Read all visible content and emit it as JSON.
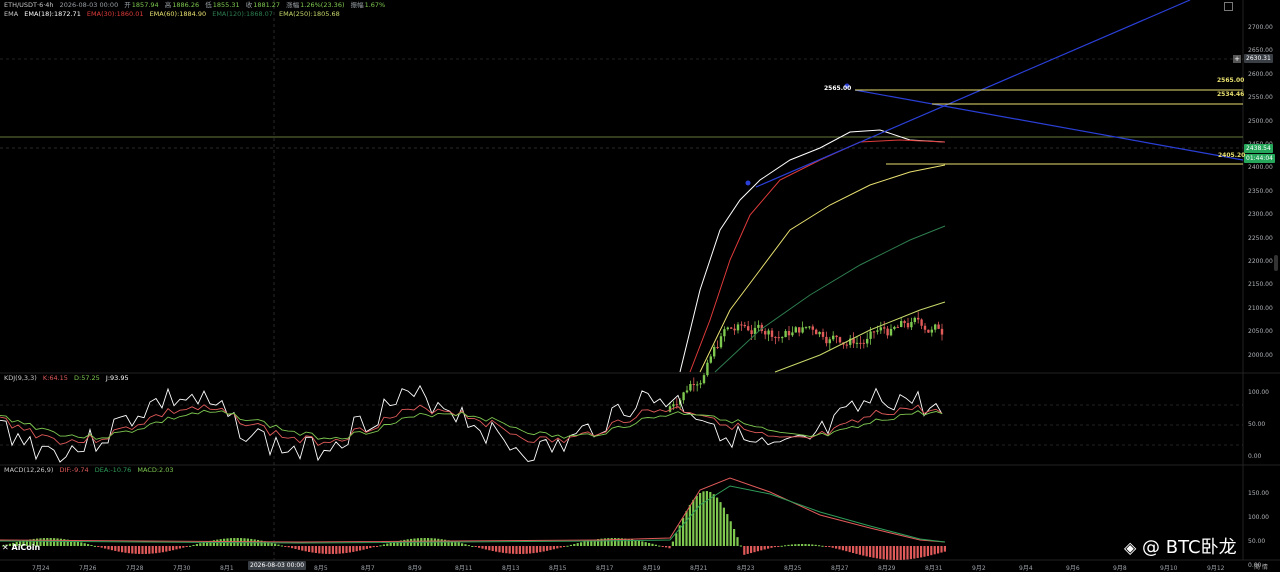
{
  "header": {
    "symbol": "ETH/USDT·6·4h",
    "datetime": "2026-08-03 00:00",
    "open_label": "开",
    "open": "1857.94",
    "high_label": "高",
    "high": "1886.26",
    "low_label": "低",
    "low": "1855.31",
    "close_label": "收",
    "close": "1881.27",
    "change_label": "涨幅",
    "change": "1.26%(23.36)",
    "amplitude_label": "振幅",
    "amplitude": "1.67%"
  },
  "ema": {
    "label": "EMA",
    "items": [
      {
        "text": "EMA(18):1872.71",
        "color": "#ffffff"
      },
      {
        "text": "EMA(30):1860.01",
        "color": "#e03b3b"
      },
      {
        "text": "EMA(60):1884.90",
        "color": "#e8e070"
      },
      {
        "text": "EMA(120):1868.07",
        "color": "#2e7d4f"
      },
      {
        "text": "EMA(250):1805.68",
        "color": "#c8d86a"
      }
    ]
  },
  "kdj": {
    "label": "KDJ(9,3,3)",
    "k": "K:64.15",
    "d": "D:57.25",
    "j": "J:93.95",
    "yaxis": [
      "100.00",
      "50.00",
      "0.00"
    ]
  },
  "macd": {
    "label": "MACD(12,26,9)",
    "dif": "DIF:-9.74",
    "dea": "DEA:-10.76",
    "macd": "MACD:2.03",
    "yaxis": [
      "150.00",
      "100.00",
      "50.00",
      "0.00"
    ]
  },
  "price_axis": [
    "2700.00",
    "2650.00",
    "2600.00",
    "2550.00",
    "2500.00",
    "2450.00",
    "2400.00",
    "2350.00",
    "2300.00",
    "2250.00",
    "2200.00",
    "2150.00",
    "2100.00",
    "2050.00",
    "2000.00"
  ],
  "price_tags": {
    "crosshair": "2630.31",
    "current": "2438.54",
    "countdown": "01:44:04"
  },
  "annotations": {
    "high_flag": "2565.00",
    "line_2565": "2565.00",
    "line_2534": "2534.46",
    "line_2405": "2405.20"
  },
  "x_axis": [
    "7月24",
    "7月26",
    "7月28",
    "7月30",
    "8月1",
    "2026-08-03 00:00",
    "8月5",
    "8月7",
    "8月9",
    "8月11",
    "8月13",
    "8月15",
    "8月17",
    "8月19",
    "8月21",
    "8月23",
    "8月25",
    "8月27",
    "8月29",
    "8月31",
    "9月2",
    "9月4",
    "9月6",
    "9月8",
    "9月10",
    "9月12"
  ],
  "watermark": {
    "left": "AiCoin",
    "right": "@ BTC卧龙",
    "corner": "简 情"
  },
  "colors": {
    "up": "#7ec850",
    "down": "#e05a5a",
    "trend": "#2a3fd6",
    "level": "#e8e070",
    "bg": "#000000"
  }
}
